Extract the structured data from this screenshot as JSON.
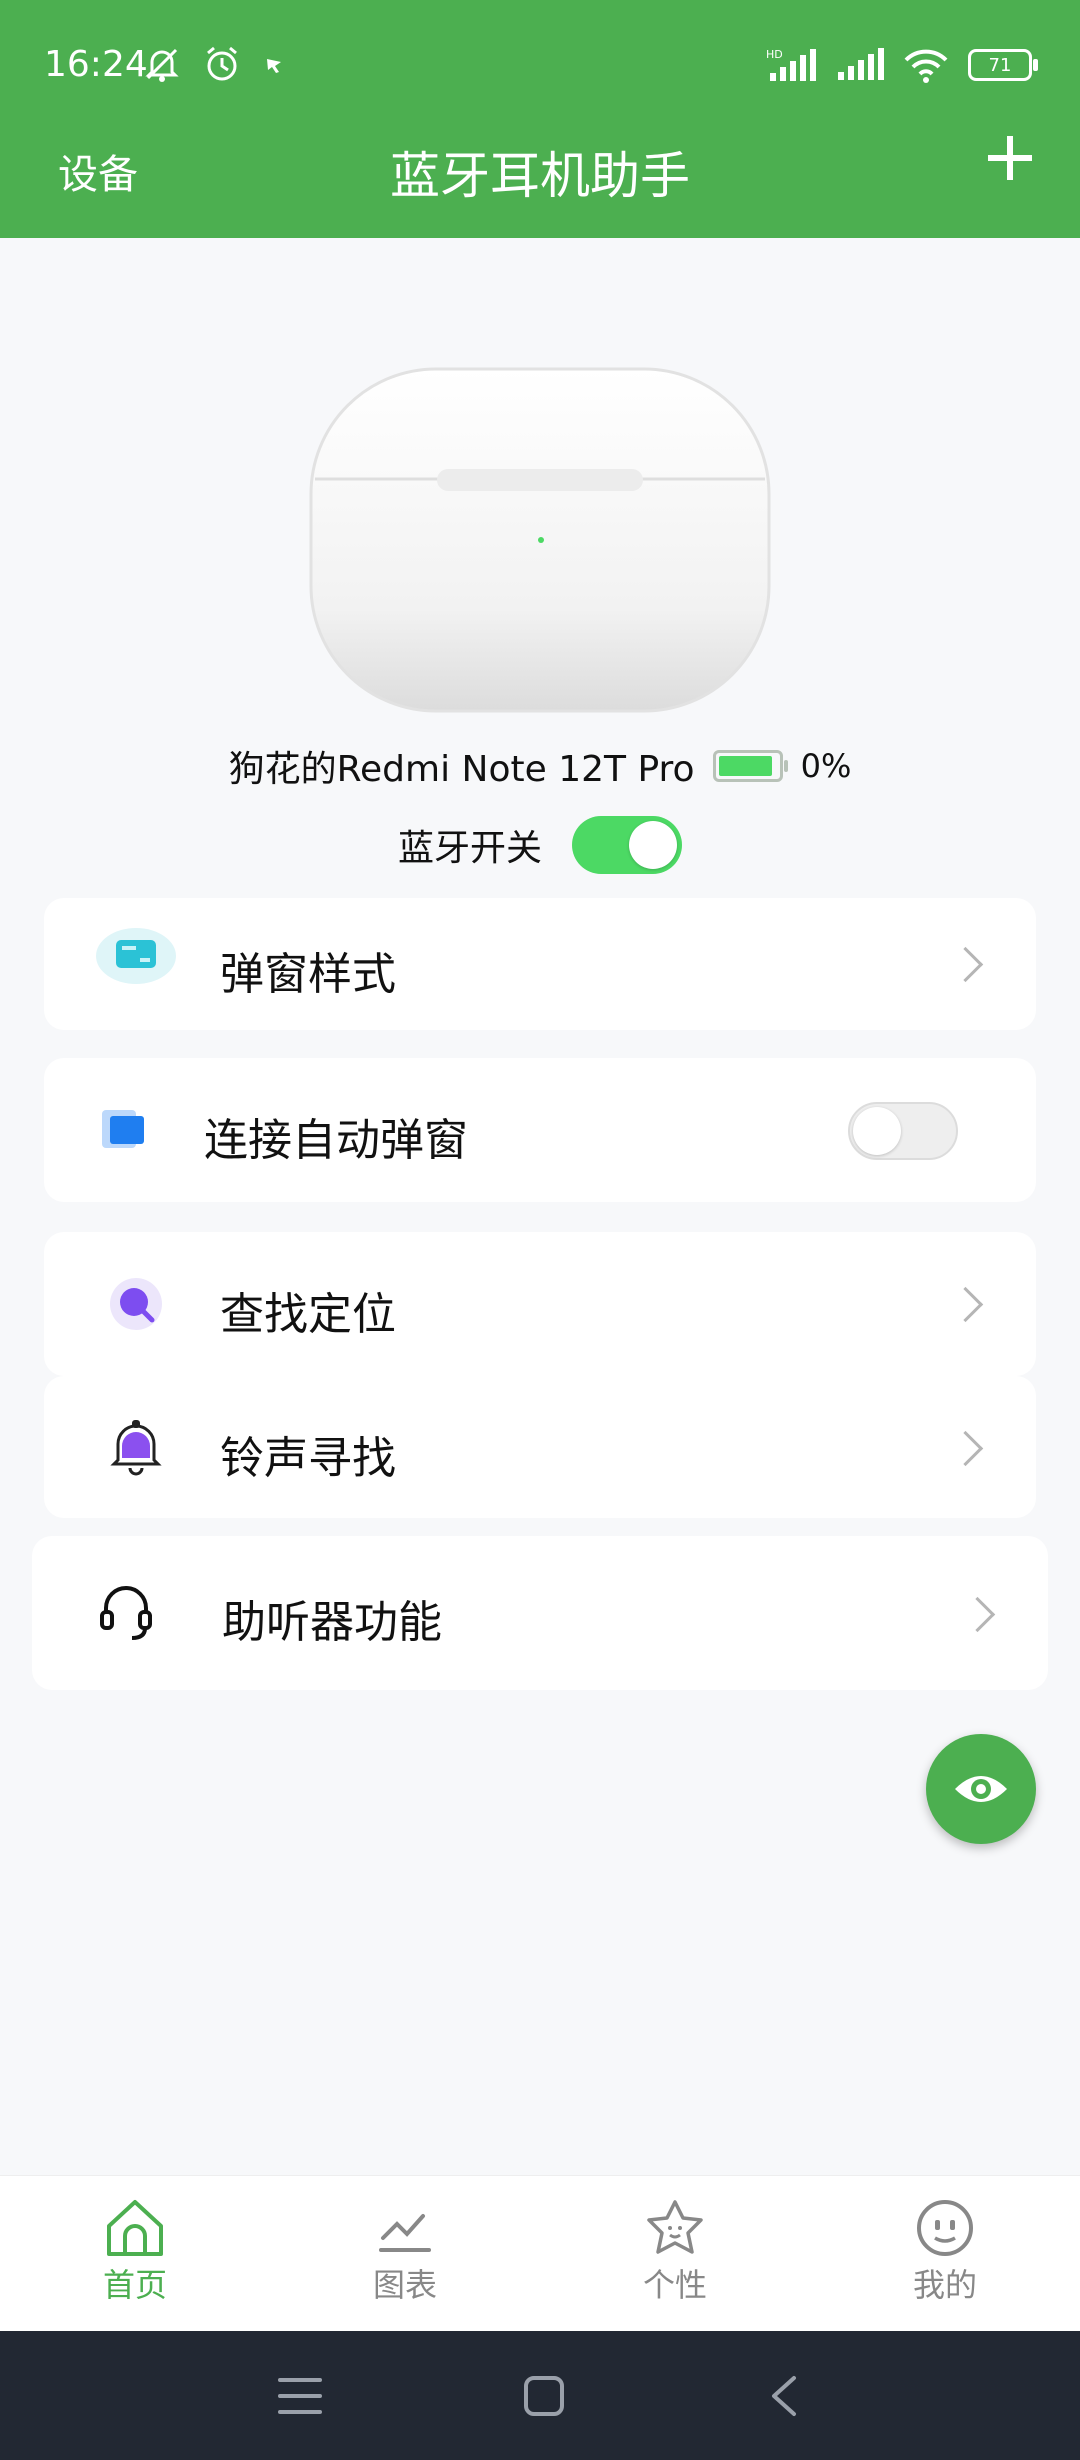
{
  "status_bar": {
    "time": "16:24",
    "battery_level": "71"
  },
  "nav": {
    "left_label": "设备",
    "title": "蓝牙耳机助手"
  },
  "device": {
    "name": "狗花的Redmi Note 12T Pro",
    "battery_text": "0%"
  },
  "bluetooth": {
    "label": "蓝牙开关",
    "enabled": true
  },
  "menu": {
    "popup_style": "弹窗样式",
    "auto_popup": "连接自动弹窗",
    "auto_popup_enabled": false,
    "find_location": "查找定位",
    "ring_find": "铃声寻找",
    "hearing_aid": "助听器功能"
  },
  "tabs": [
    {
      "label": "首页",
      "active": true
    },
    {
      "label": "图表",
      "active": false
    },
    {
      "label": "个性",
      "active": false
    },
    {
      "label": "我的",
      "active": false
    }
  ],
  "colors": {
    "brand": "#4caf50",
    "toggle_on": "#4cd964",
    "system_nav": "#222833"
  }
}
